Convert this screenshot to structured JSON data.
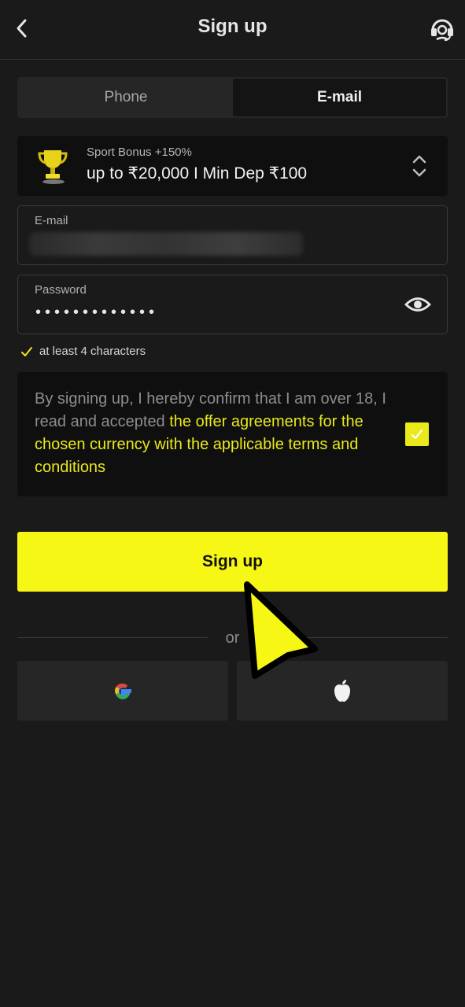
{
  "header": {
    "title": "Sign up"
  },
  "tabs": [
    {
      "label": "Phone",
      "active": false
    },
    {
      "label": "E-mail",
      "active": true
    }
  ],
  "bonus": {
    "subtitle": "Sport Bonus +150%",
    "title": "up to ₹20,000 I Min Dep ₹100"
  },
  "email": {
    "label": "E-mail",
    "value": ""
  },
  "password": {
    "label": "Password",
    "value": "•••••••••••••"
  },
  "hint": "at least 4 characters",
  "terms": {
    "text_plain": "By signing up, I hereby confirm that I am over 18, I read and accepted ",
    "text_link": "the offer agreements for the chosen currency with the applicable terms and conditions",
    "checked": true
  },
  "signup_button": "Sign up",
  "divider_text": "or",
  "colors": {
    "accent": "#f7f715",
    "background": "#1a1a1a",
    "panel": "#0f0f0f",
    "link": "#e9e91c"
  },
  "icons": [
    "chevron-left-icon",
    "headset-icon",
    "trophy-icon",
    "chevron-up-down-icon",
    "eye-icon",
    "check-icon",
    "google-icon",
    "apple-icon",
    "pointer-cursor-icon"
  ]
}
